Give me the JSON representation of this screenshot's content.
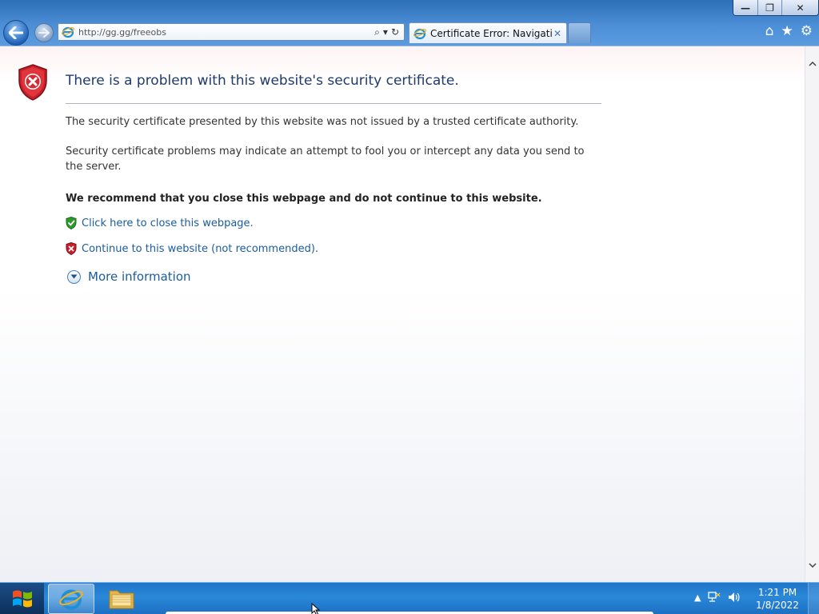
{
  "window": {
    "controls": {
      "minimize": "—",
      "restore": "❐",
      "close": "✕"
    }
  },
  "toolbar": {
    "back_icon": "back-arrow-icon",
    "forward_icon": "forward-arrow-icon",
    "address_url": "http://gg.gg/freeobs",
    "search_icon": "⌕",
    "dropdown_icon": "▾",
    "refresh_icon": "↻",
    "tab_title": "Certificate Error: Navigation...",
    "tab_close": "✕",
    "home_icon": "⌂",
    "favorites_icon": "★",
    "tools_icon": "⚙"
  },
  "page": {
    "heading": "There is a problem with this website's security certificate.",
    "paragraph_1": "The security certificate presented by this website was not issued by a trusted certificate authority.",
    "paragraph_2": "Security certificate problems may indicate an attempt to fool you or intercept any data you send to the server.",
    "recommendation": "We recommend that you close this webpage and do not continue to this website.",
    "close_link": "Click here to close this webpage.",
    "continue_link": "Continue to this website (not recommended).",
    "more_info": "More information"
  },
  "taskbar": {
    "time": "1:21 PM",
    "date": "1/8/2022",
    "tray_arrow": "▲"
  },
  "colors": {
    "link": "#1a5c9e",
    "heading": "#1f3a6b",
    "shield_red": "#c8202a",
    "shield_green": "#2e9a2e",
    "taskbar": "#2a88d8"
  }
}
